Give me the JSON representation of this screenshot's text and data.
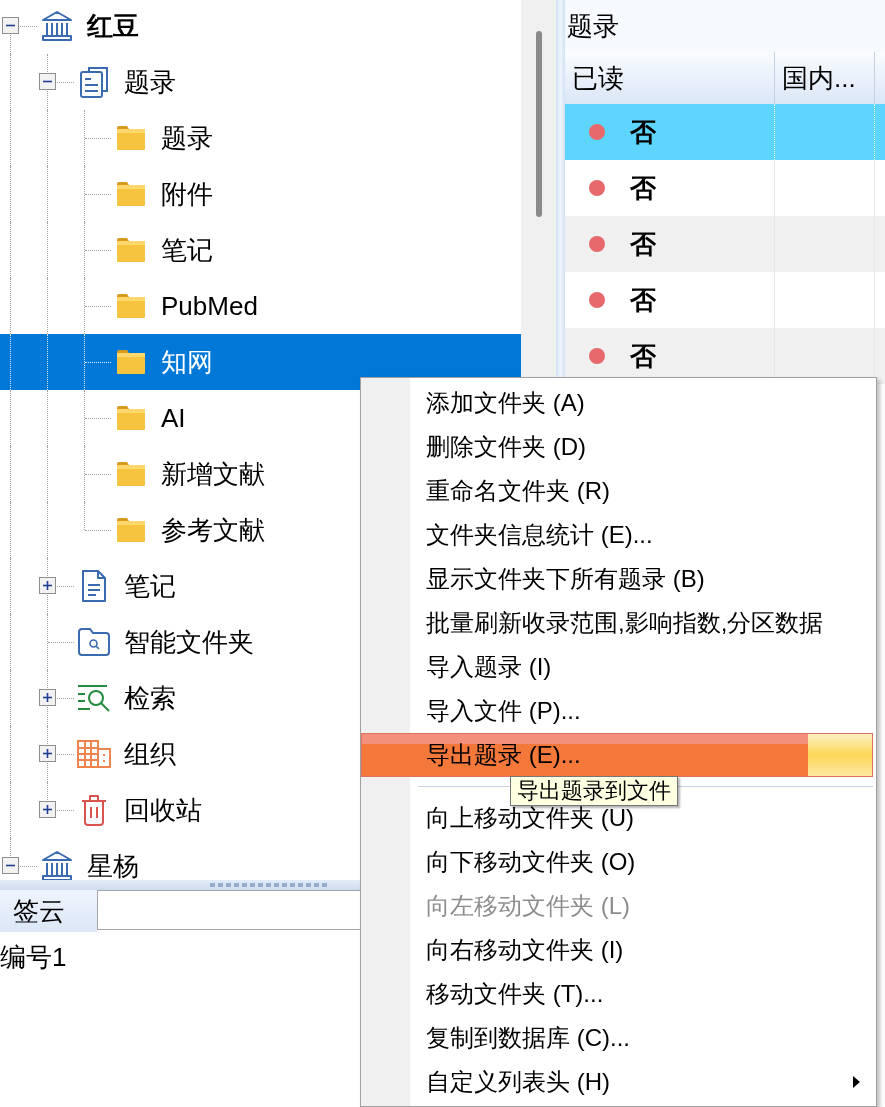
{
  "tree": [
    {
      "label": "红豆",
      "kind": "database",
      "active": true,
      "expanded": true,
      "selected": false,
      "children": [
        {
          "label": "题录",
          "kind": "records",
          "expanded": true,
          "selected": false,
          "children": [
            {
              "label": "题录",
              "kind": "folder",
              "selected": false
            },
            {
              "label": "附件",
              "kind": "folder",
              "selected": false
            },
            {
              "label": "笔记",
              "kind": "folder",
              "selected": false
            },
            {
              "label": "PubMed",
              "kind": "folder",
              "selected": false
            },
            {
              "label": "知网",
              "kind": "folder",
              "selected": true
            },
            {
              "label": "AI",
              "kind": "folder",
              "selected": false
            },
            {
              "label": "新增文献",
              "kind": "folder",
              "selected": false
            },
            {
              "label": "参考文献",
              "kind": "folder",
              "selected": false
            }
          ]
        },
        {
          "label": "笔记",
          "kind": "notes",
          "expanded": false,
          "selected": false
        },
        {
          "label": "智能文件夹",
          "kind": "smart_folder",
          "selected": false
        },
        {
          "label": "检索",
          "kind": "search",
          "expanded": false,
          "selected": false
        },
        {
          "label": "组织",
          "kind": "organize",
          "expanded": false,
          "selected": false
        },
        {
          "label": "回收站",
          "kind": "trash",
          "expanded": false,
          "selected": false
        }
      ]
    },
    {
      "label": "星杨",
      "kind": "database",
      "active": false,
      "expanded": true,
      "selected": false
    }
  ],
  "tag_cloud": {
    "label": "签云",
    "items": [
      "编号1"
    ]
  },
  "records_panel": {
    "title": "题录",
    "columns": [
      "已读",
      "国内..."
    ],
    "rows": [
      {
        "read": "否",
        "selected": true
      },
      {
        "read": "否",
        "selected": false
      },
      {
        "read": "否",
        "selected": false
      },
      {
        "read": "否",
        "selected": false
      },
      {
        "read": "否",
        "selected": false
      }
    ]
  },
  "context_menu": {
    "items": [
      {
        "kind": "item",
        "label": "添加文件夹 (A)",
        "selected": false,
        "disabled": false,
        "submenu": false
      },
      {
        "kind": "item",
        "label": "删除文件夹 (D)",
        "selected": false,
        "disabled": false,
        "submenu": false
      },
      {
        "kind": "item",
        "label": "重命名文件夹 (R)",
        "selected": false,
        "disabled": false,
        "submenu": false
      },
      {
        "kind": "item",
        "label": "文件夹信息统计 (E)...",
        "selected": false,
        "disabled": false,
        "submenu": false
      },
      {
        "kind": "item",
        "label": "显示文件夹下所有题录 (B)",
        "selected": false,
        "disabled": false,
        "submenu": false
      },
      {
        "kind": "item",
        "label": "批量刷新收录范围,影响指数,分区数据",
        "selected": false,
        "disabled": false,
        "submenu": false
      },
      {
        "kind": "item",
        "label": "导入题录 (I)",
        "selected": false,
        "disabled": false,
        "submenu": false
      },
      {
        "kind": "item",
        "label": "导入文件 (P)...",
        "selected": false,
        "disabled": false,
        "submenu": false
      },
      {
        "kind": "item",
        "label": "导出题录 (E)...",
        "selected": true,
        "disabled": false,
        "submenu": false
      },
      {
        "kind": "separator"
      },
      {
        "kind": "item",
        "label": "向上移动文件夹 (U)",
        "selected": false,
        "disabled": false,
        "submenu": false
      },
      {
        "kind": "item",
        "label": "向下移动文件夹 (O)",
        "selected": false,
        "disabled": false,
        "submenu": false
      },
      {
        "kind": "item",
        "label": "向左移动文件夹 (L)",
        "selected": false,
        "disabled": true,
        "submenu": false
      },
      {
        "kind": "item",
        "label": "向右移动文件夹 (I)",
        "selected": false,
        "disabled": false,
        "submenu": false
      },
      {
        "kind": "item",
        "label": "移动文件夹 (T)...",
        "selected": false,
        "disabled": false,
        "submenu": false
      },
      {
        "kind": "item",
        "label": "复制到数据库 (C)...",
        "selected": false,
        "disabled": false,
        "submenu": false
      },
      {
        "kind": "item",
        "label": "自定义列表头 (H)",
        "selected": false,
        "disabled": false,
        "submenu": true
      }
    ]
  },
  "tooltip": {
    "text": "导出题录到文件"
  }
}
